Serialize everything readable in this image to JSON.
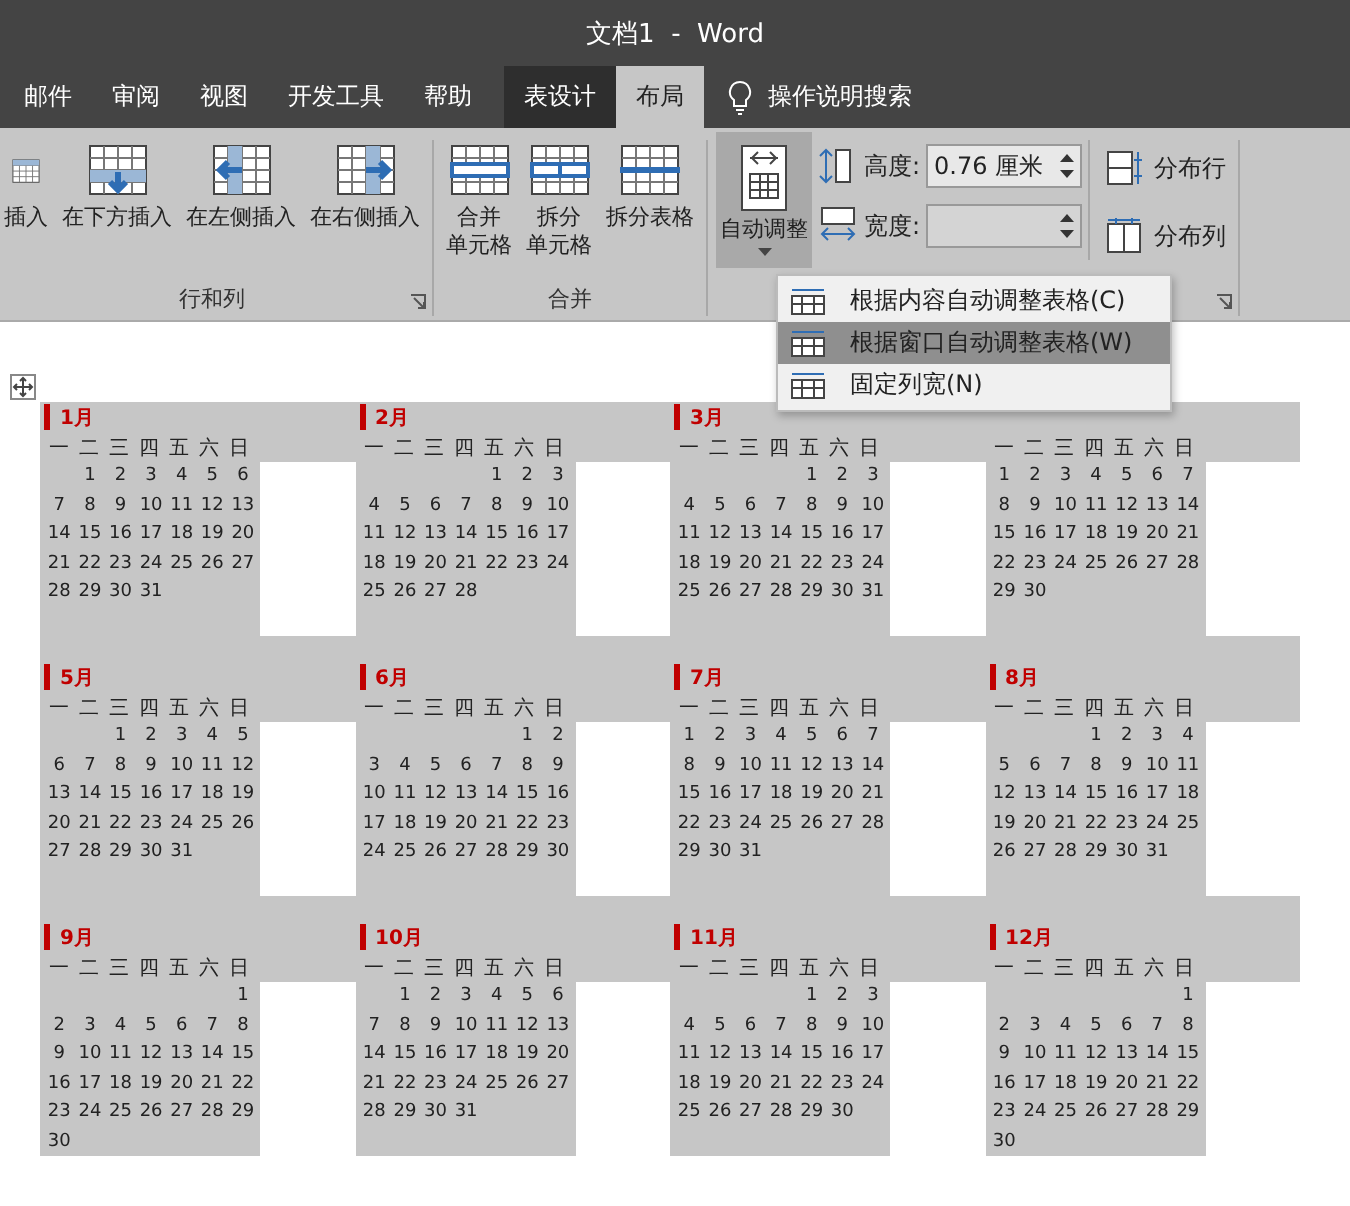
{
  "window": {
    "title": "文档1  -  Word"
  },
  "tabs": [
    {
      "label": "邮件",
      "selected": false,
      "kind": "normal"
    },
    {
      "label": "审阅",
      "selected": false,
      "kind": "normal"
    },
    {
      "label": "视图",
      "selected": false,
      "kind": "normal"
    },
    {
      "label": "开发工具",
      "selected": false,
      "kind": "normal"
    },
    {
      "label": "帮助",
      "selected": false,
      "kind": "normal"
    },
    {
      "label": "表设计",
      "selected": false,
      "kind": "context"
    },
    {
      "label": "布局",
      "selected": true,
      "kind": "context"
    }
  ],
  "tell_me": {
    "placeholder": "操作说明搜索"
  },
  "ribbon": {
    "groups": [
      {
        "label": "行和列",
        "buttons": [
          {
            "lines": [
              "插入"
            ],
            "pressed": false
          },
          {
            "lines": [
              "在下方插入"
            ],
            "pressed": false
          },
          {
            "lines": [
              "在左侧插入"
            ],
            "pressed": false
          },
          {
            "lines": [
              "在右侧插入"
            ],
            "pressed": false
          }
        ]
      },
      {
        "label": "合并",
        "buttons": [
          {
            "lines": [
              "合并",
              "单元格"
            ],
            "pressed": false
          },
          {
            "lines": [
              "拆分",
              "单元格"
            ],
            "pressed": false
          },
          {
            "lines": [
              "拆分表格"
            ],
            "pressed": false
          }
        ]
      },
      {
        "buttons": [
          {
            "lines": [
              "自动调整"
            ],
            "pressed": true,
            "dropdown": true
          }
        ],
        "fields": [
          {
            "label": "高度:",
            "value": "0.76 厘米"
          },
          {
            "label": "宽度:"
          }
        ],
        "small_buttons": [
          {
            "label": "分布行"
          },
          {
            "label": "分布列"
          }
        ]
      }
    ]
  },
  "menu": {
    "items": [
      {
        "label": "根据内容自动调整表格(C)",
        "selected": false
      },
      {
        "label": "根据窗口自动调整表格(W)",
        "selected": true
      },
      {
        "label": "固定列宽(N)",
        "selected": false
      }
    ]
  },
  "calendar": {
    "months": [
      {
        "label": "1月",
        "weekdays": [
          "一",
          "二",
          "三",
          "四",
          "五",
          "六",
          "日"
        ],
        "weeks": [
          [
            "1",
            "2",
            "3",
            "4",
            "5",
            "6"
          ],
          [
            "7",
            "8",
            "9",
            "10",
            "11",
            "12",
            "13"
          ],
          [
            "14",
            "15",
            "16",
            "17",
            "18",
            "19",
            "20"
          ],
          [
            "21",
            "22",
            "23",
            "24",
            "25",
            "26",
            "27"
          ],
          [
            "28",
            "29",
            "30",
            "31"
          ]
        ]
      },
      {
        "label": "2月",
        "weekdays": [
          "一",
          "二",
          "三",
          "四",
          "五",
          "六",
          "日"
        ],
        "weeks": [
          [
            "1",
            "2",
            "3"
          ],
          [
            "4",
            "5",
            "6",
            "7",
            "8",
            "9",
            "10"
          ],
          [
            "11",
            "12",
            "13",
            "14",
            "15",
            "16",
            "17"
          ],
          [
            "18",
            "19",
            "20",
            "21",
            "22",
            "23",
            "24"
          ],
          [
            "25",
            "26",
            "27",
            "28"
          ]
        ]
      },
      {
        "label": "3月",
        "weekdays": [
          "一",
          "二",
          "三",
          "四",
          "五",
          "六",
          "日"
        ],
        "weeks": [
          [
            "1",
            "2",
            "3"
          ],
          [
            "4",
            "5",
            "6",
            "7",
            "8",
            "9",
            "10"
          ],
          [
            "11",
            "12",
            "13",
            "14",
            "15",
            "16",
            "17"
          ],
          [
            "18",
            "19",
            "20",
            "21",
            "22",
            "23",
            "24"
          ],
          [
            "25",
            "26",
            "27",
            "28",
            "29",
            "30",
            "31"
          ]
        ]
      },
      {
        "weekdays": [
          "一",
          "二",
          "三",
          "四",
          "五",
          "六",
          "日"
        ],
        "weeks": [
          [
            "1",
            "2",
            "3",
            "4",
            "5",
            "6",
            "7"
          ],
          [
            "8",
            "9",
            "10",
            "11",
            "12",
            "13",
            "14"
          ],
          [
            "15",
            "16",
            "17",
            "18",
            "19",
            "20",
            "21"
          ],
          [
            "22",
            "23",
            "24",
            "25",
            "26",
            "27",
            "28"
          ],
          [
            "29",
            "30"
          ]
        ]
      },
      {
        "label": "5月",
        "weekdays": [
          "一",
          "二",
          "三",
          "四",
          "五",
          "六",
          "日"
        ],
        "weeks": [
          [
            "1",
            "2",
            "3",
            "4",
            "5"
          ],
          [
            "6",
            "7",
            "8",
            "9",
            "10",
            "11",
            "12"
          ],
          [
            "13",
            "14",
            "15",
            "16",
            "17",
            "18",
            "19"
          ],
          [
            "20",
            "21",
            "22",
            "23",
            "24",
            "25",
            "26"
          ],
          [
            "27",
            "28",
            "29",
            "30",
            "31"
          ]
        ]
      },
      {
        "label": "6月",
        "weekdays": [
          "一",
          "二",
          "三",
          "四",
          "五",
          "六",
          "日"
        ],
        "weeks": [
          [
            "1",
            "2"
          ],
          [
            "3",
            "4",
            "5",
            "6",
            "7",
            "8",
            "9"
          ],
          [
            "10",
            "11",
            "12",
            "13",
            "14",
            "15",
            "16"
          ],
          [
            "17",
            "18",
            "19",
            "20",
            "21",
            "22",
            "23"
          ],
          [
            "24",
            "25",
            "26",
            "27",
            "28",
            "29",
            "30"
          ]
        ]
      },
      {
        "label": "7月",
        "weekdays": [
          "一",
          "二",
          "三",
          "四",
          "五",
          "六",
          "日"
        ],
        "weeks": [
          [
            "1",
            "2",
            "3",
            "4",
            "5",
            "6",
            "7"
          ],
          [
            "8",
            "9",
            "10",
            "11",
            "12",
            "13",
            "14"
          ],
          [
            "15",
            "16",
            "17",
            "18",
            "19",
            "20",
            "21"
          ],
          [
            "22",
            "23",
            "24",
            "25",
            "26",
            "27",
            "28"
          ],
          [
            "29",
            "30",
            "31"
          ]
        ]
      },
      {
        "label": "8月",
        "weekdays": [
          "一",
          "二",
          "三",
          "四",
          "五",
          "六",
          "日"
        ],
        "weeks": [
          [
            "1",
            "2",
            "3",
            "4"
          ],
          [
            "5",
            "6",
            "7",
            "8",
            "9",
            "10",
            "11"
          ],
          [
            "12",
            "13",
            "14",
            "15",
            "16",
            "17",
            "18"
          ],
          [
            "19",
            "20",
            "21",
            "22",
            "23",
            "24",
            "25"
          ],
          [
            "26",
            "27",
            "28",
            "29",
            "30",
            "31"
          ]
        ]
      },
      {
        "label": "9月",
        "weekdays": [
          "一",
          "二",
          "三",
          "四",
          "五",
          "六",
          "日"
        ],
        "weeks": [
          [
            "1"
          ],
          [
            "2",
            "3",
            "4",
            "5",
            "6",
            "7",
            "8"
          ],
          [
            "9",
            "10",
            "11",
            "12",
            "13",
            "14",
            "15"
          ],
          [
            "16",
            "17",
            "18",
            "19",
            "20",
            "21",
            "22"
          ],
          [
            "23",
            "24",
            "25",
            "26",
            "27",
            "28",
            "29"
          ],
          [
            "30"
          ]
        ]
      },
      {
        "label": "10月",
        "weekdays": [
          "一",
          "二",
          "三",
          "四",
          "五",
          "六",
          "日"
        ],
        "weeks": [
          [
            "1",
            "2",
            "3",
            "4",
            "5",
            "6"
          ],
          [
            "7",
            "8",
            "9",
            "10",
            "11",
            "12",
            "13"
          ],
          [
            "14",
            "15",
            "16",
            "17",
            "18",
            "19",
            "20"
          ],
          [
            "21",
            "22",
            "23",
            "24",
            "25",
            "26",
            "27"
          ],
          [
            "28",
            "29",
            "30",
            "31"
          ]
        ]
      },
      {
        "label": "11月",
        "weekdays": [
          "一",
          "二",
          "三",
          "四",
          "五",
          "六",
          "日"
        ],
        "weeks": [
          [
            "1",
            "2",
            "3"
          ],
          [
            "4",
            "5",
            "6",
            "7",
            "8",
            "9",
            "10"
          ],
          [
            "11",
            "12",
            "13",
            "14",
            "15",
            "16",
            "17"
          ],
          [
            "18",
            "19",
            "20",
            "21",
            "22",
            "23",
            "24"
          ],
          [
            "25",
            "26",
            "27",
            "28",
            "29",
            "30"
          ]
        ]
      },
      {
        "label": "12月",
        "weekdays": [
          "一",
          "二",
          "三",
          "四",
          "五",
          "六",
          "日"
        ],
        "weeks": [
          [
            "1"
          ],
          [
            "2",
            "3",
            "4",
            "5",
            "6",
            "7",
            "8"
          ],
          [
            "9",
            "10",
            "11",
            "12",
            "13",
            "14",
            "15"
          ],
          [
            "16",
            "17",
            "18",
            "19",
            "20",
            "21",
            "22"
          ],
          [
            "23",
            "24",
            "25",
            "26",
            "27",
            "28",
            "29"
          ],
          [
            "30"
          ]
        ]
      }
    ]
  }
}
